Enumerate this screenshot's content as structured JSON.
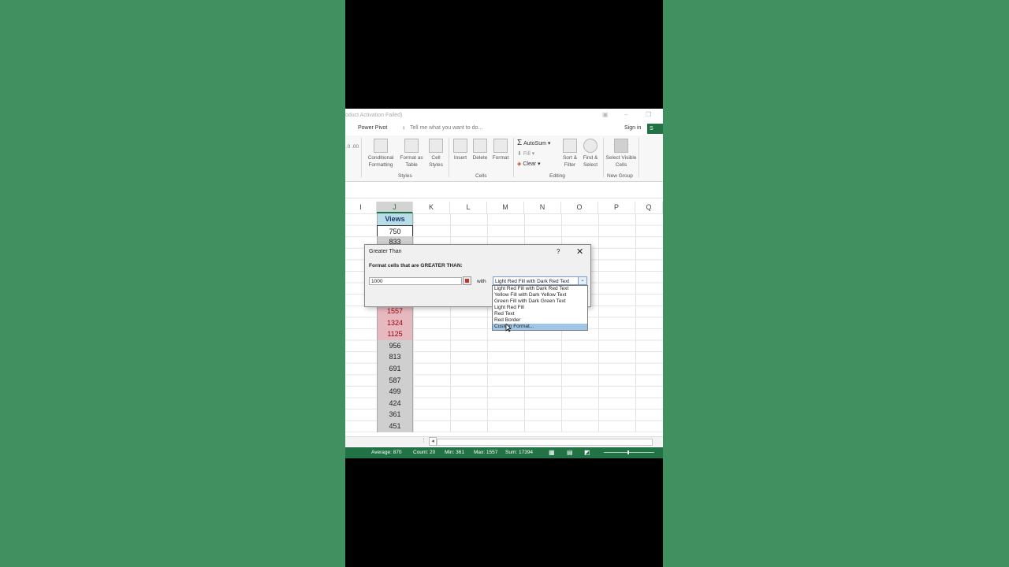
{
  "window": {
    "title": "oduct Activation Failed)"
  },
  "ribbon": {
    "tab_power_pivot": "Power Pivot",
    "tell_me": "Tell me what you want to do...",
    "sign_in": "Sign in",
    "share": "S",
    "buttons": {
      "conditional_formatting": "Conditional Formatting",
      "format_as_table": "Format as Table",
      "cell_styles": "Cell Styles",
      "insert": "Insert",
      "delete": "Delete",
      "format": "Format",
      "autosum": "AutoSum",
      "fill": "Fill",
      "clear": "Clear",
      "sort_filter": "Sort & Filter",
      "find_select": "Find & Select",
      "select_visible_cells": "Select Visible Cells"
    },
    "groups": {
      "styles": "Styles",
      "cells": "Cells",
      "editing": "Editing",
      "new_group": "New Group"
    },
    "number_fmt": ".0 .00"
  },
  "columns": [
    "I",
    "J",
    "K",
    "L",
    "M",
    "N",
    "O",
    "P",
    "Q"
  ],
  "sheet": {
    "header": "Views",
    "first": "750",
    "second": "833",
    "values_visible": [
      "1557",
      "1324",
      "1125",
      "956",
      "813",
      "691",
      "587",
      "499",
      "424",
      "361",
      "451"
    ]
  },
  "dialog": {
    "title": "Greater Than",
    "help": "?",
    "close": "✕",
    "prompt": "Format cells that are GREATER THAN:",
    "value": "1000",
    "with_label": "with",
    "selected_format": "Light Red Fill with Dark Red Text",
    "options": [
      "Light Red Fill with Dark Red Text",
      "Yellow Fill with Dark Yellow Text",
      "Green Fill with Dark Green Text",
      "Light Red Fill",
      "Red Text",
      "Red Border",
      "Custom Format..."
    ]
  },
  "status_bar": {
    "average": "Average: 870",
    "count": "Count: 20",
    "min": "Min: 361",
    "max": "Max: 1557",
    "sum": "Sum: 17394"
  },
  "colors": {
    "background_green": "#41905f",
    "excel_green": "#217346",
    "highlight_fill": "#e6b9c0",
    "highlight_text": "#9c0006"
  }
}
